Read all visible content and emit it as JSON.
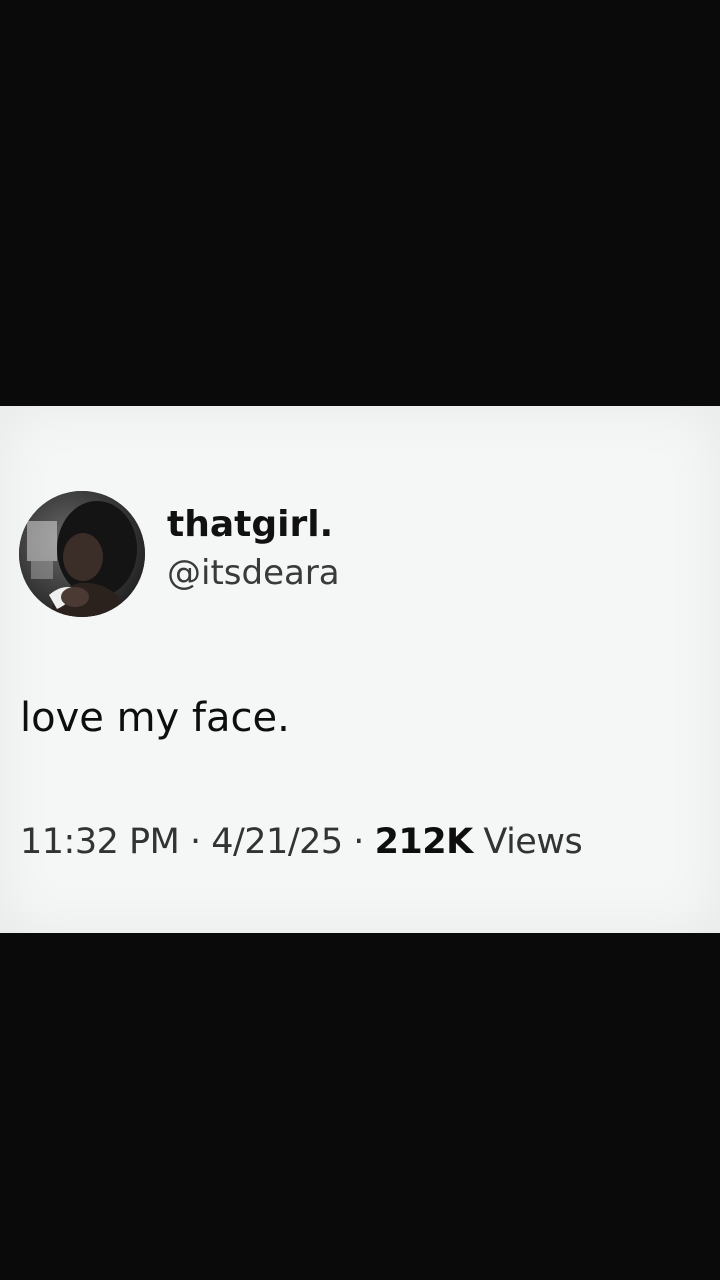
{
  "tweet": {
    "display_name": "thatgirl.",
    "handle": "@itsdeara",
    "text": "love my face.",
    "time": "11:32 PM",
    "date": "4/21/25",
    "separator": "·",
    "views_count": "212K",
    "views_label": "Views"
  },
  "colors": {
    "background": "#0a0a0a",
    "card": "#f4f7f6",
    "text": "#0e0e0e",
    "muted": "#3a3a3a"
  }
}
